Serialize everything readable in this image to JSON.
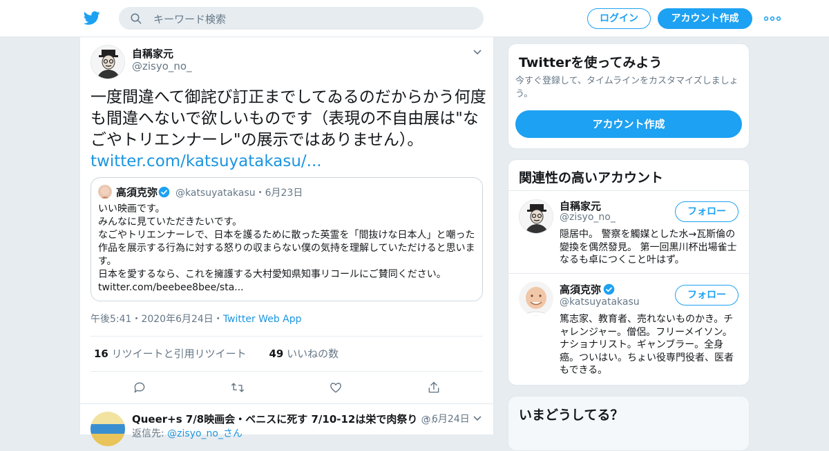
{
  "header": {
    "search_placeholder": "キーワード検索",
    "login_label": "ログイン",
    "signup_label": "アカウント作成"
  },
  "tweet": {
    "author_name": "自稱家元",
    "author_handle": "@zisyo_no_",
    "text": "一度間違へて御詫び訂正までしてゐるのだからかう何度も間違へないで欲しいものです（表現の不自由展は\"なごやトリエンナーレ\"の展示ではありません）。",
    "link": "twitter.com/katsuyatakasu/...",
    "quote": {
      "name": "高須克弥",
      "handle": "@katsuyatakasu",
      "date": "・6月23日",
      "lines": [
        "いい映画です。",
        "みんなに見ていただきたいです。",
        "なごやトリエンナーレで、日本を護るために散った英霊を「間抜けな日本人」と嘲った作品を展示する行為に対する怒りの収まらない僕の気持を理解していただけると思います。",
        "日本を愛するなら、これを擁護する大村愛知県知事リコールにご賛同ください。",
        "twitter.com/beebee8bee/sta..."
      ]
    },
    "time": "午後5:41",
    "date": "・2020年6月24日・",
    "source": "Twitter Web App",
    "retweets_count": "16",
    "retweets_label": "リツイートと引用リツイート",
    "likes_count": "49",
    "likes_label": "いいねの数"
  },
  "next_tweet": {
    "name": "Queer+s 7/8映画会・ベニスに死す 7/10-12は栄で肉祭り",
    "handle": "@..",
    "date": "・6月24日",
    "reply_prefix": "返信先: ",
    "reply_to": "@zisyo_no_さん"
  },
  "sidebar": {
    "signup_card": {
      "title": "Twitterを使ってみよう",
      "subtitle": "今すぐ登録して、タイムラインをカスタマイズしましょう。",
      "button": "アカウント作成"
    },
    "related": {
      "title": "関連性の高いアカウント",
      "follow_label": "フォロー",
      "accounts": [
        {
          "name": "自稱家元",
          "handle": "@zisyo_no_",
          "bio": "隠居中。 警察を觸媒とした水→瓦斯倫の變換を偶然發見。 第一回黒川杯出場雀士なるも卓につくこと叶はず。"
        },
        {
          "name": "高須克弥",
          "handle": "@katsuyatakasu",
          "bio": "篤志家、教育者、売れないものかき。チャレンジャー。僧侶。フリーメイソン。ナショナリスト。ギャンブラー。全身癌。ついはい。ちょい役専門役者、医者もできる。"
        }
      ]
    },
    "whats_happening": {
      "title": "いまどうしてる？"
    }
  },
  "colors": {
    "brand": "#1da1f2",
    "link": "#1b95e0",
    "muted": "#657786",
    "background": "#e6ecf0"
  }
}
